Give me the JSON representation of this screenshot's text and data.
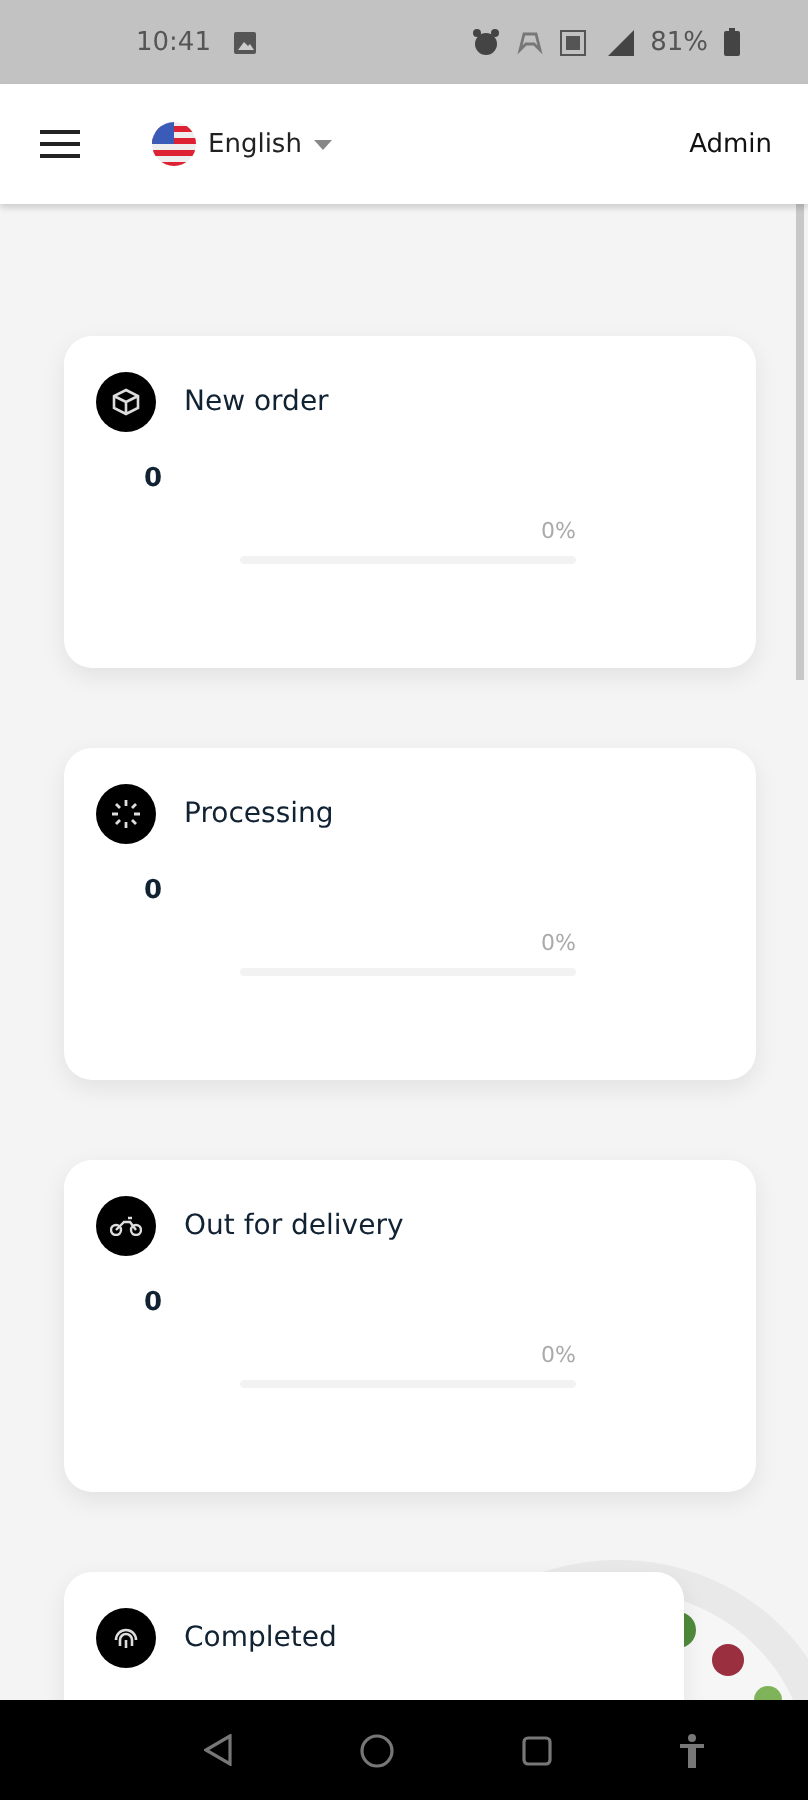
{
  "status_bar": {
    "time": "10:41",
    "battery": "81%"
  },
  "header": {
    "language": "English",
    "user": "Admin"
  },
  "cards": [
    {
      "kind": "box",
      "title": "New order",
      "count": "0",
      "percent": "0%",
      "level": 0
    },
    {
      "kind": "spinner",
      "title": "Processing",
      "count": "0",
      "percent": "0%",
      "level": 0
    },
    {
      "kind": "motorbike",
      "title": "Out for delivery",
      "count": "0",
      "percent": "0%",
      "level": 0
    },
    {
      "kind": "fingerprint",
      "title": "Completed"
    }
  ]
}
